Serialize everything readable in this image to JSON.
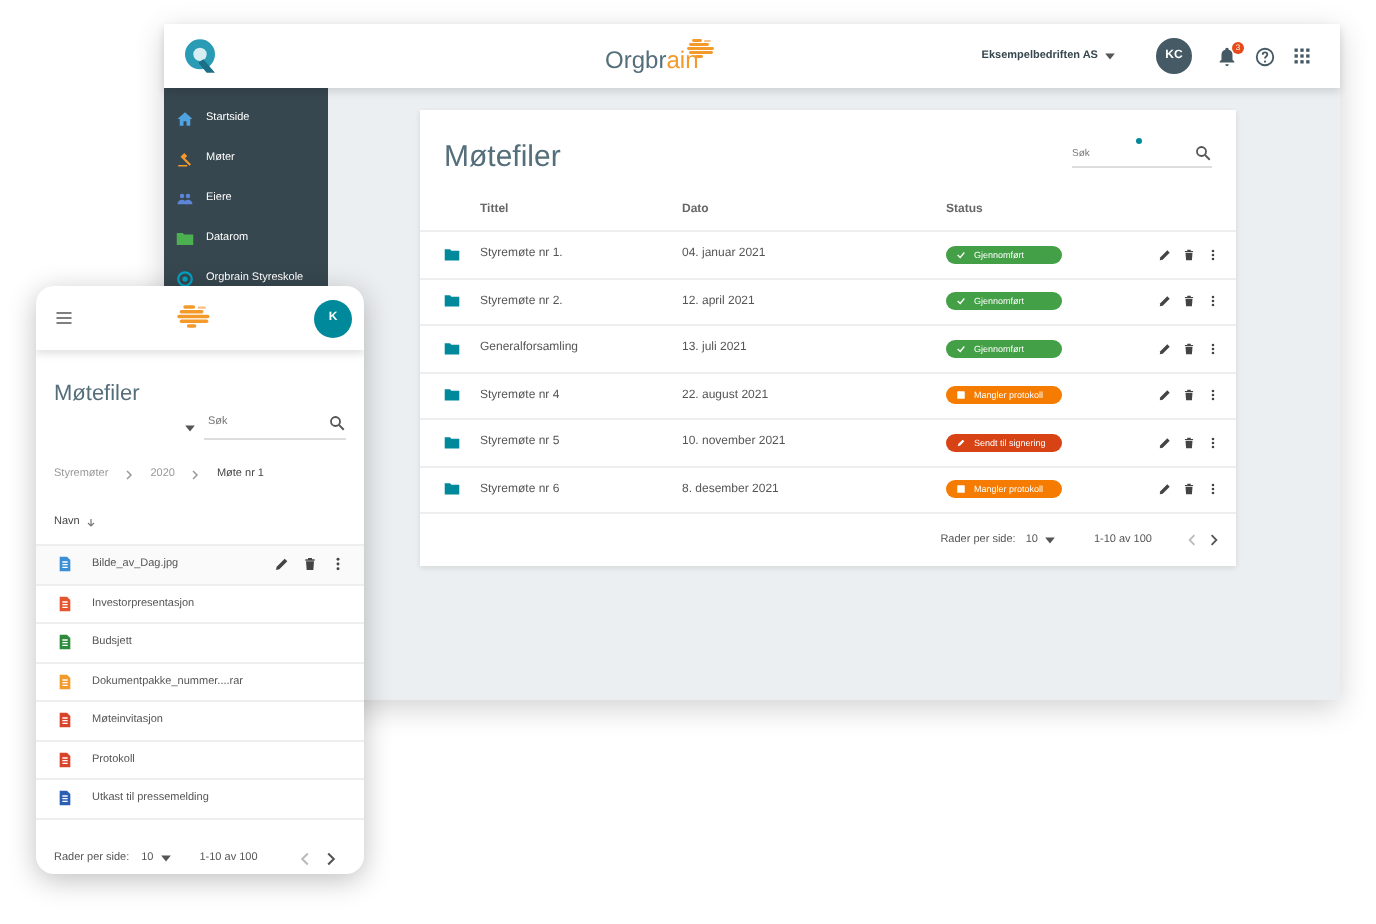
{
  "desktop": {
    "header": {
      "logo_parts": [
        "Orgbr",
        "ain"
      ],
      "company": "Eksempelbedriften AS",
      "avatar": "KC",
      "notification_count": "3"
    },
    "sidebar": {
      "items": [
        {
          "label": "Startside",
          "kind": "home"
        },
        {
          "label": "Møter",
          "kind": "gavel"
        },
        {
          "label": "Eiere",
          "kind": "people"
        },
        {
          "label": "Datarom",
          "kind": "folder"
        },
        {
          "label": "Orgbrain Styreskole",
          "kind": "school"
        }
      ]
    },
    "card": {
      "title": "Møtefiler",
      "search": {
        "placeholder": "Søk"
      },
      "table": {
        "columns": [
          "Tittel",
          "Dato",
          "Status"
        ],
        "rows": [
          {
            "title": "Styremøte nr 1.",
            "date": "04. januar 2021",
            "status": {
              "label": "Gjennomført",
              "kind": "done"
            }
          },
          {
            "title": "Styremøte nr 2.",
            "date": "12. april 2021",
            "status": {
              "label": "Gjennomført",
              "kind": "done"
            }
          },
          {
            "title": "Generalforsamling",
            "date": "13. juli 2021",
            "status": {
              "label": "Gjennomført",
              "kind": "done"
            }
          },
          {
            "title": "Styremøte nr 4",
            "date": "22. august 2021",
            "status": {
              "label": "Mangler protokoll",
              "kind": "missing"
            }
          },
          {
            "title": "Styremøte nr 5",
            "date": "10. november 2021",
            "status": {
              "label": "Sendt til signering",
              "kind": "signing"
            }
          },
          {
            "title": "Styremøte nr 6",
            "date": "8. desember 2021",
            "status": {
              "label": "Mangler protokoll",
              "kind": "missing"
            }
          }
        ]
      },
      "pagination": {
        "rows_label": "Rader per side:",
        "rows_value": "10",
        "range": "1-10 av 100"
      }
    }
  },
  "phone": {
    "avatar": "K",
    "title": "Møtefiler",
    "search": {
      "placeholder": "Søk"
    },
    "breadcrumbs": [
      "Styremøter",
      "2020",
      "Møte nr 1"
    ],
    "sort_column": "Navn",
    "files": [
      {
        "name": "Bilde_av_Dag.jpg",
        "kind": "image",
        "hovered": true
      },
      {
        "name": "Investorpresentasjon",
        "kind": "powerpoint",
        "hovered": false
      },
      {
        "name": "Budsjett",
        "kind": "excel",
        "hovered": false
      },
      {
        "name": "Dokumentpakke_nummer....rar",
        "kind": "archive",
        "hovered": false
      },
      {
        "name": "Møteinvitasjon",
        "kind": "pdf",
        "hovered": false
      },
      {
        "name": "Protokoll",
        "kind": "pdf",
        "hovered": false
      },
      {
        "name": "Utkast til pressemelding",
        "kind": "word",
        "hovered": false
      }
    ],
    "pagination": {
      "rows_label": "Rader per side:",
      "rows_value": "10",
      "range": "1-10 av 100"
    }
  }
}
